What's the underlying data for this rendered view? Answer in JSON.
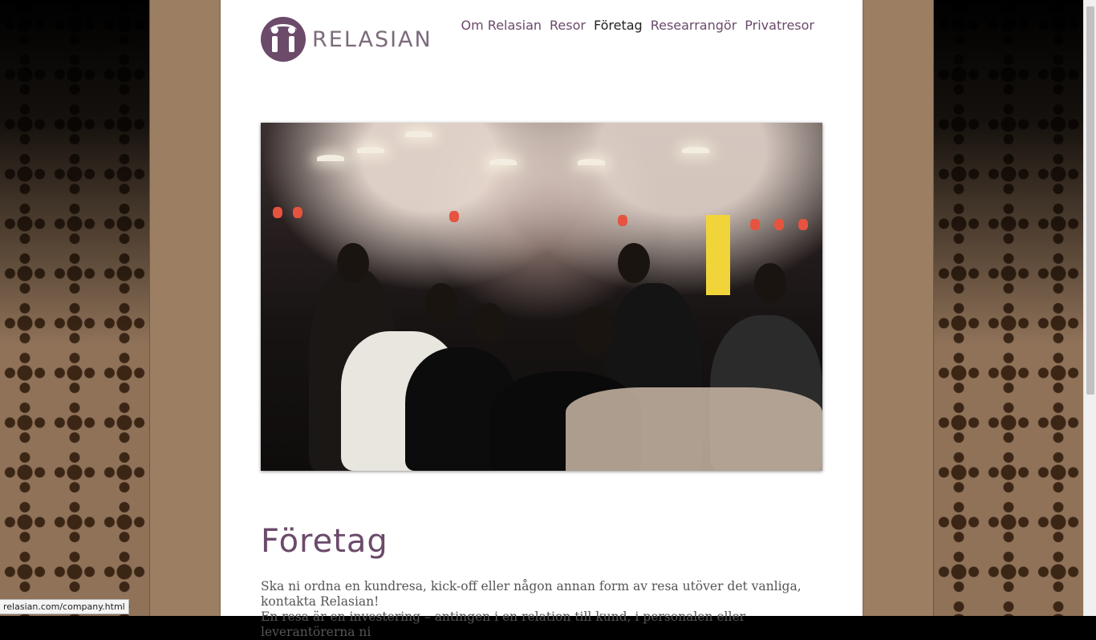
{
  "logo": {
    "text": "RELASIAN"
  },
  "nav": {
    "items": [
      {
        "label": "Om Relasian"
      },
      {
        "label": "Resor"
      },
      {
        "label": "Företag"
      },
      {
        "label": "Researrangör"
      },
      {
        "label": "Privatresor"
      }
    ],
    "active": "Företag"
  },
  "hero": {
    "image": "crowd-dining-under-cherry-blossoms-photo"
  },
  "page": {
    "title": "Företag",
    "paragraphs": [
      "Ska ni ordna en kundresa, kick-off eller någon annan form av resa utöver det vanliga, kontakta Relasian!",
      "En resa är en investering – antingen i en relation till kund, i personalen eller leverantörerna ni"
    ]
  },
  "status_bar": {
    "url": "relasian.com/company.html"
  },
  "colors": {
    "brand": "#6b4a6a",
    "frame": "#9c7f63"
  }
}
